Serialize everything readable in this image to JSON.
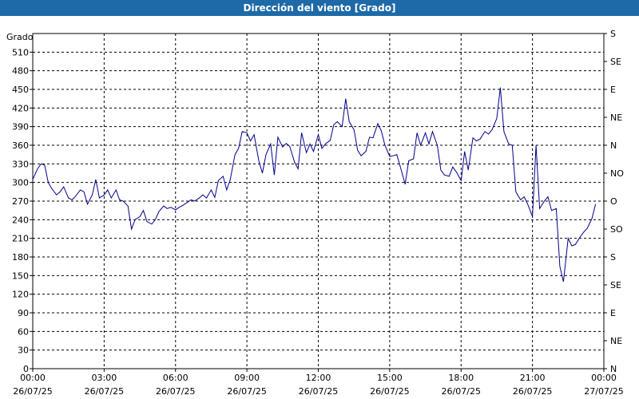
{
  "chart_data": {
    "type": "line",
    "title": "Dirección del viento [Grado]",
    "ylabel": "Grado",
    "ylim": [
      0,
      540
    ],
    "y_ticks": [
      0,
      30,
      60,
      90,
      120,
      150,
      180,
      210,
      240,
      270,
      300,
      330,
      360,
      390,
      420,
      450,
      480,
      510
    ],
    "right_ticks": [
      {
        "value": 0,
        "label": "N"
      },
      {
        "value": 45,
        "label": "NE"
      },
      {
        "value": 90,
        "label": "E"
      },
      {
        "value": 135,
        "label": "SE"
      },
      {
        "value": 180,
        "label": "S"
      },
      {
        "value": 225,
        "label": "SO"
      },
      {
        "value": 270,
        "label": "O"
      },
      {
        "value": 315,
        "label": "NO"
      },
      {
        "value": 360,
        "label": "N"
      },
      {
        "value": 405,
        "label": "NE"
      },
      {
        "value": 450,
        "label": "E"
      },
      {
        "value": 495,
        "label": "SE"
      },
      {
        "value": 540,
        "label": "S"
      }
    ],
    "x_ticks": [
      {
        "time": "00:00",
        "date": "26/07/25"
      },
      {
        "time": "03:00",
        "date": "26/07/25"
      },
      {
        "time": "06:00",
        "date": "26/07/25"
      },
      {
        "time": "09:00",
        "date": "26/07/25"
      },
      {
        "time": "12:00",
        "date": "26/07/25"
      },
      {
        "time": "15:00",
        "date": "26/07/25"
      },
      {
        "time": "18:00",
        "date": "26/07/25"
      },
      {
        "time": "21:00",
        "date": "26/07/25"
      },
      {
        "time": "00:00",
        "date": "27/07/25"
      }
    ],
    "xlim_hours": [
      0,
      24
    ],
    "grid": true,
    "series": [
      {
        "color": "#00008b",
        "x_hours": [
          0,
          0.2,
          0.35,
          0.5,
          0.65,
          0.8,
          1.0,
          1.15,
          1.3,
          1.5,
          1.65,
          1.8,
          2.0,
          2.15,
          2.3,
          2.5,
          2.65,
          2.8,
          3.0,
          3.15,
          3.3,
          3.5,
          3.65,
          3.8,
          4.0,
          4.15,
          4.3,
          4.5,
          4.65,
          4.8,
          5.0,
          5.15,
          5.3,
          5.5,
          5.65,
          5.8,
          6.0,
          6.15,
          6.3,
          6.5,
          6.65,
          6.8,
          7.0,
          7.15,
          7.3,
          7.5,
          7.65,
          7.8,
          8.0,
          8.15,
          8.3,
          8.5,
          8.65,
          8.8,
          9.0,
          9.15,
          9.3,
          9.5,
          9.65,
          9.8,
          10.0,
          10.15,
          10.3,
          10.5,
          10.65,
          10.8,
          11.0,
          11.15,
          11.3,
          11.5,
          11.65,
          11.8,
          12.0,
          12.15,
          12.3,
          12.5,
          12.65,
          12.8,
          13.0,
          13.15,
          13.3,
          13.5,
          13.65,
          13.8,
          14.0,
          14.15,
          14.3,
          14.5,
          14.65,
          14.8,
          15.0,
          15.15,
          15.3,
          15.5,
          15.65,
          15.8,
          16.0,
          16.15,
          16.3,
          16.5,
          16.65,
          16.8,
          17.0,
          17.15,
          17.3,
          17.5,
          17.65,
          17.8,
          18.0,
          18.15,
          18.3,
          18.5,
          18.65,
          18.8,
          19.0,
          19.15,
          19.3,
          19.5,
          19.65,
          19.8,
          20.0,
          20.15,
          20.3,
          20.5,
          20.65,
          20.8,
          21.0,
          21.15,
          21.3,
          21.5,
          21.65,
          21.8,
          22.0,
          22.15,
          22.3,
          22.5,
          22.65,
          22.8,
          23.0,
          23.15,
          23.3,
          23.5,
          23.65,
          23.8,
          24.0
        ],
        "values": [
          305,
          322,
          330,
          328,
          300,
          290,
          280,
          285,
          293,
          275,
          272,
          278,
          288,
          285,
          265,
          280,
          305,
          275,
          280,
          288,
          275,
          288,
          272,
          270,
          262,
          225,
          240,
          245,
          255,
          237,
          233,
          240,
          253,
          262,
          258,
          260,
          256,
          260,
          263,
          268,
          272,
          270,
          275,
          280,
          275,
          288,
          276,
          303,
          310,
          288,
          305,
          345,
          355,
          382,
          380,
          367,
          377,
          335,
          315,
          345,
          362,
          312,
          373,
          357,
          363,
          358,
          333,
          322,
          380,
          348,
          362,
          350,
          377,
          355,
          362,
          368,
          393,
          398,
          390,
          435,
          398,
          385,
          352,
          343,
          350,
          373,
          372,
          395,
          383,
          360,
          342,
          343,
          345,
          318,
          297,
          335,
          338,
          380,
          360,
          380,
          362,
          382,
          360,
          320,
          312,
          310,
          325,
          317,
          303,
          350,
          320,
          372,
          367,
          370,
          382,
          378,
          385,
          403,
          453,
          382,
          362,
          360,
          285,
          272,
          277,
          265,
          245,
          360,
          258,
          270,
          277,
          255,
          258,
          165,
          140,
          210,
          198,
          200,
          212,
          220,
          226,
          242,
          265
        ]
      }
    ]
  }
}
